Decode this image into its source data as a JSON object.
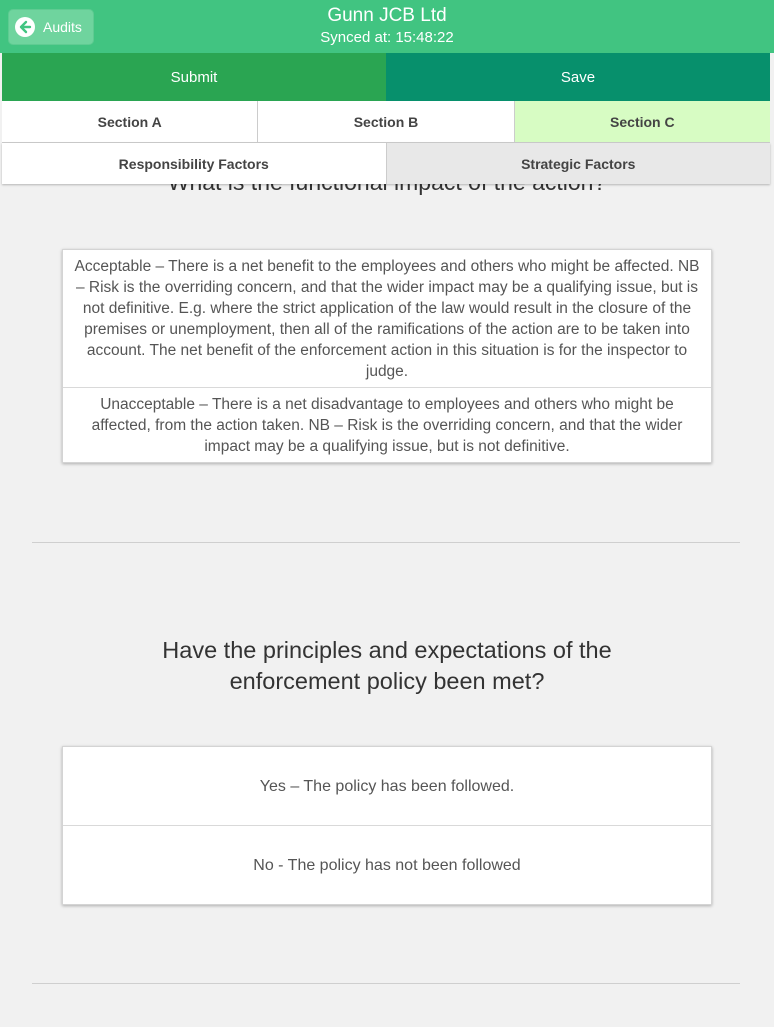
{
  "header": {
    "back_label": "Audits",
    "title": "Gunn JCB Ltd",
    "synced_label": "Synced at: 15:48:22"
  },
  "actions": {
    "submit": "Submit",
    "save": "Save"
  },
  "sections": [
    {
      "label": "Section A"
    },
    {
      "label": "Section B"
    },
    {
      "label": "Section C",
      "active": true
    }
  ],
  "sub_tabs": [
    {
      "label": "Responsibility Factors"
    },
    {
      "label": "Strategic Factors"
    }
  ],
  "questions": [
    {
      "text": "What is the functional impact of the action?",
      "options": [
        "Acceptable – There is a net benefit to the employees and others who might be affected. NB – Risk is the overriding concern, and that the wider impact may be a qualifying issue, but is not definitive. E.g. where the strict application of the law would result in the closure of the premises or unemployment, then all of the ramifications of the action are to be taken into account. The net benefit of the enforcement action in this situation is for the inspector to judge.",
        "Unacceptable – There is a net disadvantage to employees and others who might be affected, from the action taken. NB – Risk is the overriding concern, and that the wider impact may be a qualifying issue, but is not definitive."
      ]
    },
    {
      "text": "Have the principles and expectations of the enforcement policy been met?",
      "options": [
        "Yes – The policy has been followed.",
        "No - The policy has not been followed"
      ]
    }
  ],
  "colors": {
    "header": "#41c481",
    "submit": "#2aa552",
    "save": "#07906c",
    "active_section": "#d7fcc3"
  }
}
